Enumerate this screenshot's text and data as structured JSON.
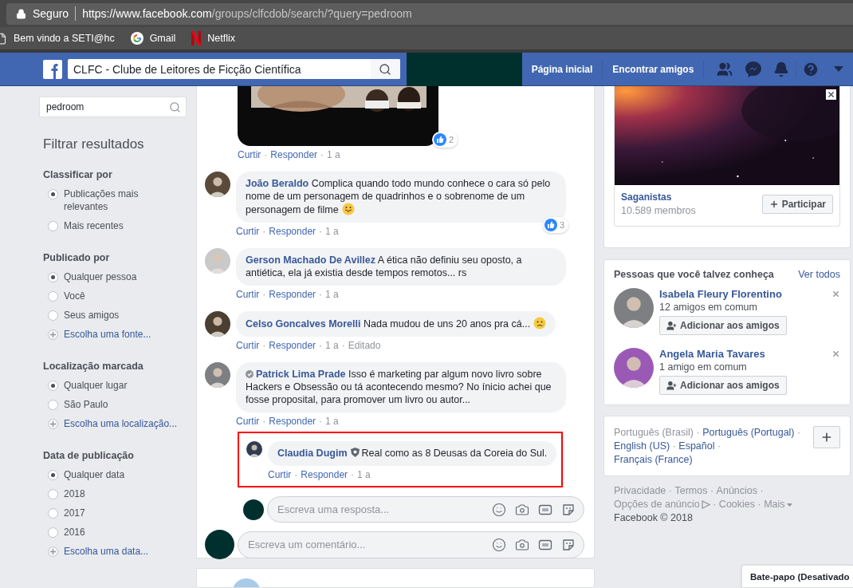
{
  "browser": {
    "secure_label": "Seguro",
    "url_host": "https://www.facebook.com",
    "url_path": "/groups/clfcdob/search/?query=pedroom",
    "bookmarks": [
      {
        "label": "Bem vindo a SETI@hc",
        "kind": "page"
      },
      {
        "label": "Gmail",
        "kind": "google"
      },
      {
        "label": "Netflix",
        "kind": "netflix"
      }
    ]
  },
  "header": {
    "group_search": "CLFC - Clube de Leitores de Ficção Científica",
    "nav": [
      "Página inicial",
      "Encontrar amigos"
    ]
  },
  "sidebar": {
    "search": "pedroom",
    "title": "Filtrar resultados",
    "sections": [
      {
        "title": "Classificar por",
        "options": [
          {
            "label": "Publicações mais relevantes",
            "kind": "radio",
            "selected": true
          },
          {
            "label": "Mais recentes",
            "kind": "radio",
            "selected": false
          }
        ]
      },
      {
        "title": "Publicado por",
        "options": [
          {
            "label": "Qualquer pessoa",
            "kind": "radio",
            "selected": true
          },
          {
            "label": "Você",
            "kind": "radio",
            "selected": false
          },
          {
            "label": "Seus amigos",
            "kind": "radio",
            "selected": false
          },
          {
            "label": "Escolha uma fonte...",
            "kind": "add"
          }
        ]
      },
      {
        "title": "Localização marcada",
        "options": [
          {
            "label": "Qualquer lugar",
            "kind": "radio",
            "selected": true
          },
          {
            "label": "São Paulo",
            "kind": "radio",
            "selected": false
          },
          {
            "label": "Escolha uma localização...",
            "kind": "add"
          }
        ]
      },
      {
        "title": "Data de publicação",
        "options": [
          {
            "label": "Qualquer data",
            "kind": "radio",
            "selected": true
          },
          {
            "label": "2018",
            "kind": "radio",
            "selected": false
          },
          {
            "label": "2017",
            "kind": "radio",
            "selected": false
          },
          {
            "label": "2016",
            "kind": "radio",
            "selected": false
          },
          {
            "label": "Escolha uma data...",
            "kind": "add"
          }
        ]
      }
    ]
  },
  "feed": {
    "separator": "·",
    "post_reactions": "2",
    "post_actions": [
      {
        "label": "Curtir",
        "kind": "link"
      },
      {
        "label": "Responder",
        "kind": "link"
      },
      {
        "label": "1 a",
        "kind": "meta"
      }
    ],
    "comments": [
      {
        "author": "João Beraldo",
        "text": "Complica quando todo mundo conhece o cara só pelo nome de um personagem de quadrinhos e o sobrenome de um personagem de filme",
        "emoji": {
          "kind": "tongue"
        },
        "reactions": "3",
        "actions": [
          {
            "label": "Curtir",
            "kind": "link"
          },
          {
            "label": "Responder",
            "kind": "link"
          },
          {
            "label": "1 a",
            "kind": "meta"
          }
        ]
      },
      {
        "author": "Gerson Machado De Avillez",
        "text": "A ética não definiu seu oposto, a antiética, ela já existia desde tempos remotos... rs",
        "actions": [
          {
            "label": "Curtir",
            "kind": "link"
          },
          {
            "label": "Responder",
            "kind": "link"
          },
          {
            "label": "1 a",
            "kind": "meta"
          }
        ]
      },
      {
        "author": "Celso Goncalves Morelli",
        "text": "Nada mudou de uns 20 anos pra cá...",
        "emoji": {
          "kind": "sad"
        },
        "actions": [
          {
            "label": "Curtir",
            "kind": "link"
          },
          {
            "label": "Responder",
            "kind": "link"
          },
          {
            "label": "1 a",
            "kind": "meta"
          },
          {
            "label": "Editado",
            "kind": "meta"
          }
        ]
      },
      {
        "author": "Patrick Lima Prade",
        "badge": {
          "kind": "check"
        },
        "text": "Isso é marketing par algum novo livro sobre Hackers e Obsessão ou tá acontecendo mesmo? No ínicio achei que fosse proposital, para promover um livro ou autor...",
        "actions": [
          {
            "label": "Curtir",
            "kind": "link"
          },
          {
            "label": "Responder",
            "kind": "link"
          },
          {
            "label": "1 a",
            "kind": "meta"
          }
        ],
        "replies": [
          {
            "author": "Claudia Dugim",
            "badge": {
              "kind": "shield"
            },
            "highlighted": true,
            "text": "Real como as 8 Deusas da Coreia do Sul.",
            "actions": [
              {
                "label": "Curtir",
                "kind": "link"
              },
              {
                "label": "Responder",
                "kind": "link"
              },
              {
                "label": "1 a",
                "kind": "meta"
              }
            ]
          }
        ]
      }
    ],
    "reply_placeholder": "Escreva uma resposta...",
    "comment_placeholder": "Escreva um comentário..."
  },
  "right": {
    "suggested_group": {
      "name": "Saganistas",
      "members": "10.589 membros",
      "join_label": "Participar"
    },
    "people": {
      "title": "Pessoas que você talvez conheça",
      "see_all": "Ver todos",
      "items": [
        {
          "name": "Isabela Fleury Florentino",
          "mutual": "12 amigos em comum",
          "action": "Adicionar aos amigos"
        },
        {
          "name": "Angela Maria Tavares",
          "mutual": "1 amigo em comum",
          "action": "Adicionar aos amigos"
        }
      ]
    },
    "languages": [
      {
        "label": "Português (Brasil)",
        "selected": true
      },
      {
        "label": "Português (Portugal)",
        "selected": false
      },
      {
        "label": "English (US)",
        "selected": false
      },
      {
        "label": "Español",
        "selected": false
      },
      {
        "label": "Français (France)",
        "selected": false
      }
    ],
    "footer_links": [
      {
        "label": "Privacidade",
        "kind": "link"
      },
      {
        "label": "Termos",
        "kind": "link"
      },
      {
        "label": "Anúncios",
        "kind": "link"
      },
      {
        "label": "Opções de anúncio",
        "kind": "adchoices"
      },
      {
        "label": "Cookies",
        "kind": "link"
      },
      {
        "label": "Mais",
        "kind": "menu"
      }
    ],
    "copyright": "Facebook © 2018"
  },
  "chat": {
    "label": "Bate-papo (Desativado"
  }
}
